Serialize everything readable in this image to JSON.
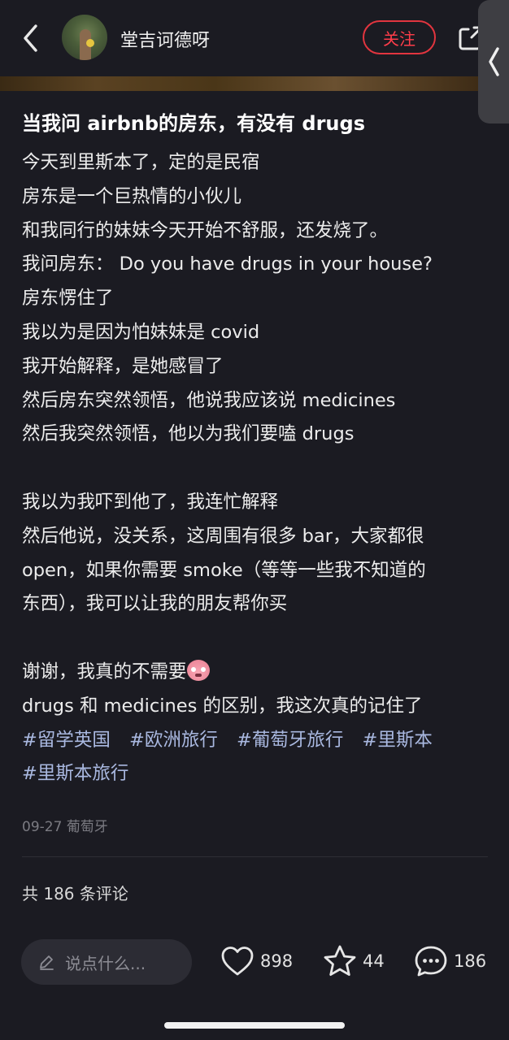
{
  "header": {
    "author_name": "堂吉诃德呀",
    "follow_label": "关注"
  },
  "post": {
    "title": "当我问 airbnb的房东，有没有 drugs",
    "lines": [
      "今天到里斯本了，定的是民宿",
      "房东是一个巨热情的小伙儿",
      "和我同行的妹妹今天开始不舒服，还发烧了。",
      "我问房东：  Do you have drugs in your house?",
      "房东愣住了",
      "我以为是因为怕妹妹是 covid",
      "我开始解释，是她感冒了",
      "然后房东突然领悟，他说我应该说 medicines",
      "然后我突然领悟，他以为我们要嗑 drugs",
      "",
      "我以为我吓到他了，我连忙解释",
      "然后他说，没关系，这周围有很多 bar，大家都很",
      "open，如果你需要 smoke（等等一些我不知道的",
      "东西），我可以让我的朋友帮你买",
      "",
      "谢谢，我真的不需要",
      "drugs 和 medicines 的区别，我这次真的记住了"
    ],
    "tags": [
      "#留学英国",
      "#欧洲旅行",
      "#葡萄牙旅行",
      "#里斯本",
      "#里斯本旅行"
    ],
    "meta": "09-27 葡萄牙"
  },
  "comments": {
    "count_label": "共 186 条评论"
  },
  "bottom_bar": {
    "input_placeholder": "说点什么...",
    "likes": "898",
    "favorites": "44",
    "comments": "186"
  },
  "colors": {
    "background": "#1b1b22",
    "accent_red": "#e2353f",
    "tag_color": "#a9b8e0"
  },
  "icons": [
    "back-icon",
    "share-icon",
    "collapse-icon",
    "pencil-icon",
    "heart-icon",
    "star-icon",
    "comment-icon"
  ]
}
